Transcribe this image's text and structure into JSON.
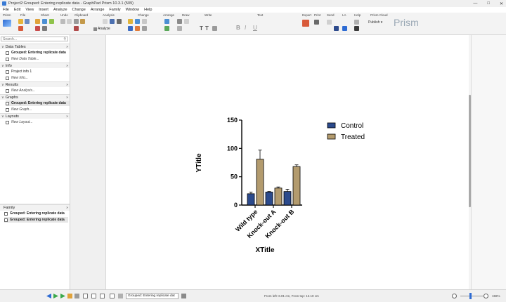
{
  "window": {
    "title": "Project2:Grouped: Entering replicate data - GraphPad Prism 10.3.1 (509)"
  },
  "menu": [
    "File",
    "Edit",
    "View",
    "Insert",
    "Analyze",
    "Change",
    "Arrange",
    "Family",
    "Window",
    "Help"
  ],
  "ribbon": {
    "groups": [
      "Prism",
      "File",
      "Sheet",
      "Undo",
      "Clipboard",
      "Analysis",
      "Change",
      "Arrange",
      "Draw",
      "Write",
      "Text",
      "Export",
      "Print",
      "Send",
      "LA",
      "Help",
      "Prism Cloud"
    ],
    "analyze_label": "Analyze",
    "publish_label": "Publish",
    "brand": "Prism"
  },
  "navigator": {
    "search_placeholder": "Search...",
    "sections": [
      {
        "label": "Data Tables",
        "items": [
          {
            "label": "Grouped: Entering replicate data"
          },
          {
            "label": "New Data Table..."
          }
        ]
      },
      {
        "label": "Info",
        "items": [
          {
            "label": "Project info 1"
          },
          {
            "label": "New Info..."
          }
        ]
      },
      {
        "label": "Results",
        "items": [
          {
            "label": "New Analysis..."
          }
        ]
      },
      {
        "label": "Graphs",
        "items": [
          {
            "label": "Grouped: Entering replicate data"
          },
          {
            "label": "New Graph..."
          }
        ]
      },
      {
        "label": "Layouts",
        "items": [
          {
            "label": "New Layout..."
          }
        ]
      }
    ],
    "family": {
      "label": "Family",
      "items": [
        {
          "label": "Grouped: Entering replicate data"
        },
        {
          "label": "Grouped: Entering replicate data"
        }
      ]
    }
  },
  "status": {
    "sheet_selector": "Grouped: Entering replicate dat",
    "position": "From left: 6.01 cm, From top: 12.10 cm",
    "zoom": "159%"
  },
  "colors": {
    "control": "#2b4a8c",
    "treated": "#b39b6e",
    "accent": "#2d6bd3"
  },
  "chart_data": {
    "type": "bar",
    "categories": [
      "Wild type",
      "Knock-out A",
      "Knock-out B"
    ],
    "series": [
      {
        "name": "Control",
        "values": [
          20,
          23,
          24
        ],
        "errors": [
          3,
          1,
          4
        ]
      },
      {
        "name": "Treated",
        "values": [
          81,
          30,
          68
        ],
        "errors": [
          16,
          2,
          3
        ]
      }
    ],
    "xlabel": "XTitle",
    "ylabel": "YTitle",
    "ylim": [
      0,
      150
    ],
    "yticks": [
      0,
      50,
      100,
      150
    ],
    "legend": "top-right",
    "grid": false
  }
}
